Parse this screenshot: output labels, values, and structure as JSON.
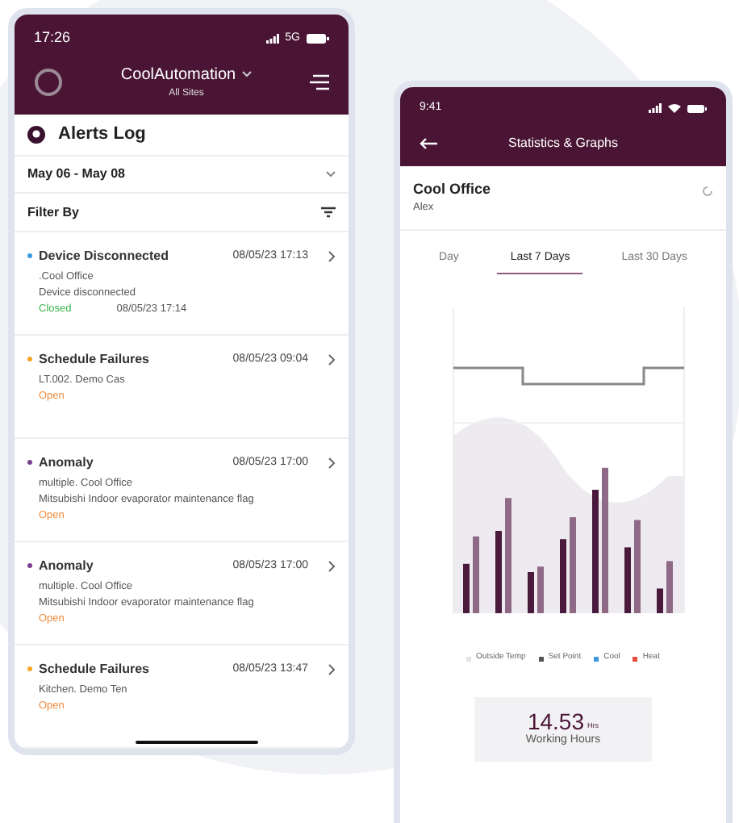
{
  "left_phone": {
    "status_bar": {
      "time": "17:26",
      "network": "5G"
    },
    "header": {
      "title": "CoolAutomation",
      "subtitle": "All Sites"
    },
    "page_title": "Alerts Log",
    "date_range": "May 06 - May 08",
    "filter_label": "Filter By",
    "alerts": [
      {
        "title": "Device Disconnected",
        "time": "08/05/23 17:13",
        "color": "#3b9ae1",
        "lines": [
          ".Cool Office",
          "Device disconnected"
        ],
        "status": "Closed",
        "kind": "closed",
        "closed_time": "08/05/23 17:14"
      },
      {
        "title": "Schedule Failures",
        "time": "08/05/23 09:04",
        "color": "#f5a623",
        "lines": [
          "LT.002. Demo Cas"
        ],
        "status": "Open",
        "kind": "open"
      },
      {
        "title": "Anomaly",
        "time": "08/05/23 17:00",
        "color": "#7b3f8f",
        "lines": [
          "multiple. Cool Office",
          "Mitsubishi Indoor evaporator maintenance flag"
        ],
        "status": "Open",
        "kind": "open"
      },
      {
        "title": "Anomaly",
        "time": "08/05/23 17:00",
        "color": "#7b3f8f",
        "lines": [
          "multiple. Cool Office",
          "Mitsubishi Indoor evaporator maintenance flag"
        ],
        "status": "Open",
        "kind": "open"
      },
      {
        "title": "Schedule Failures",
        "time": "08/05/23 13:47",
        "color": "#f5a623",
        "lines": [
          "Kitchen. Demo Ten"
        ],
        "status": "Open",
        "kind": "open"
      }
    ]
  },
  "right_phone": {
    "status_bar": {
      "time": "9:41"
    },
    "header": {
      "title": "Statistics & Graphs"
    },
    "site": {
      "name": "Cool Office",
      "user": "Alex"
    },
    "tabs": [
      {
        "label": "Day",
        "selected": false
      },
      {
        "label": "Last 7 Days",
        "selected": true
      },
      {
        "label": "Last 30 Days",
        "selected": false
      }
    ],
    "legend": [
      {
        "label": "Outside Temp",
        "color": "#e5e2e8"
      },
      {
        "label": "Set Point",
        "color": "#555555"
      },
      {
        "label": "Cool",
        "color": "#3b9ae1"
      },
      {
        "label": "Heat",
        "color": "#e74c3c"
      }
    ],
    "summary": {
      "value": "14.53",
      "unit": "Hrs",
      "label": "Working Hours"
    }
  }
}
